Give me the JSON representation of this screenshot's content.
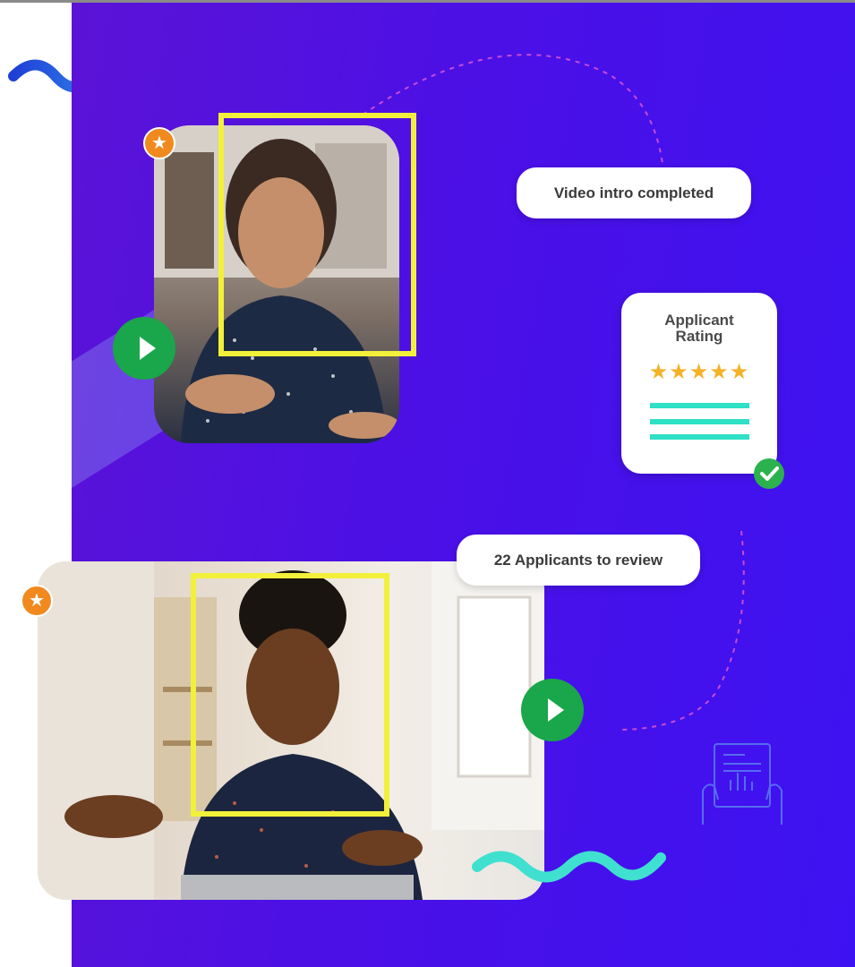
{
  "cards": {
    "video_intro": "Video intro completed",
    "applicants": "22 Applicants to review"
  },
  "rating": {
    "title_line1": "Applicant",
    "title_line2": "Rating",
    "stars": "★★★★★",
    "star_count": 5
  },
  "icons": {
    "star_badge": "star-icon",
    "play": "play-icon",
    "check": "check-icon",
    "document": "document-chart-icon",
    "star_glyph": "★"
  },
  "colors": {
    "panel": "#4b10e6",
    "highlight_frame": "#f2f03a",
    "play_button": "#1aa64a",
    "star_badge": "#f08a1f",
    "teal": "#2ee0c6",
    "stars": "#f3b228"
  }
}
